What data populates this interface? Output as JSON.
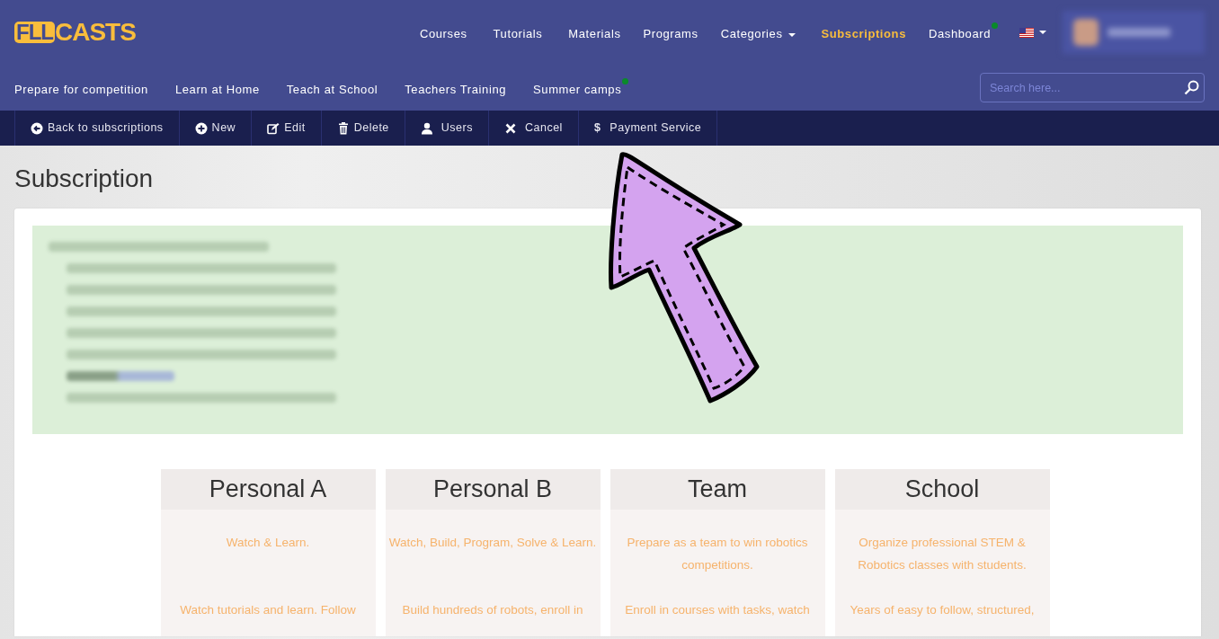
{
  "logo": {
    "boxed": "FLL",
    "text": "CASTS"
  },
  "main_nav": [
    {
      "label": "Courses",
      "selected": false,
      "dropdown": false,
      "notify": false
    },
    {
      "label": "Tutorials",
      "selected": false,
      "dropdown": false,
      "notify": false
    },
    {
      "label": "Materials",
      "selected": false,
      "dropdown": false,
      "notify": false
    },
    {
      "label": "Programs",
      "selected": false,
      "dropdown": false,
      "notify": false
    },
    {
      "label": "Categories",
      "selected": false,
      "dropdown": true,
      "notify": false
    },
    {
      "label": "Subscriptions",
      "selected": true,
      "dropdown": false,
      "notify": false
    },
    {
      "label": "Dashboard",
      "selected": false,
      "dropdown": false,
      "notify": true
    }
  ],
  "language_menu": {
    "dropdown": true
  },
  "user_menu": {
    "blurred": true
  },
  "sub_nav": [
    {
      "label": "Prepare for competition",
      "notify": false
    },
    {
      "label": "Learn at Home",
      "notify": false
    },
    {
      "label": "Teach at School",
      "notify": false
    },
    {
      "label": "Teachers Training",
      "notify": false
    },
    {
      "label": "Summer camps",
      "notify": true
    }
  ],
  "search": {
    "placeholder": "Search here..."
  },
  "toolbar": [
    {
      "kind": "back",
      "label": "Back to subscriptions"
    },
    {
      "kind": "new",
      "label": "New"
    },
    {
      "kind": "edit",
      "label": "Edit"
    },
    {
      "kind": "delete",
      "label": "Delete"
    },
    {
      "kind": "users",
      "label": "Users"
    },
    {
      "kind": "cancel",
      "label": "Cancel"
    },
    {
      "kind": "dollar",
      "symbol": "$",
      "label": "Payment Service"
    }
  ],
  "page_title": "Subscription",
  "subscription_info": {
    "blurred": true,
    "lines": [
      {
        "kind": "intro"
      },
      {
        "kind": "item",
        "link": false
      },
      {
        "kind": "item",
        "link": false
      },
      {
        "kind": "item",
        "link": false
      },
      {
        "kind": "item",
        "link": false
      },
      {
        "kind": "item",
        "link": false
      },
      {
        "kind": "item",
        "link": true
      },
      {
        "kind": "item",
        "link": false
      }
    ]
  },
  "plans": [
    {
      "name": "Personal A",
      "tagline": "Watch & Learn.",
      "description": "Watch tutorials and learn. Follow"
    },
    {
      "name": "Personal B",
      "tagline": "Watch, Build, Program, Solve & Learn.",
      "description": "Build hundreds of robots, enroll in"
    },
    {
      "name": "Team",
      "tagline": "Prepare as a team to win robotics competitions.",
      "description": "Enroll in courses with tasks, watch"
    },
    {
      "name": "School",
      "tagline": "Organize professional STEM & Robotics classes with students.",
      "description": "Years of easy to follow, structured,"
    }
  ],
  "annotation": {
    "kind": "arrow"
  }
}
